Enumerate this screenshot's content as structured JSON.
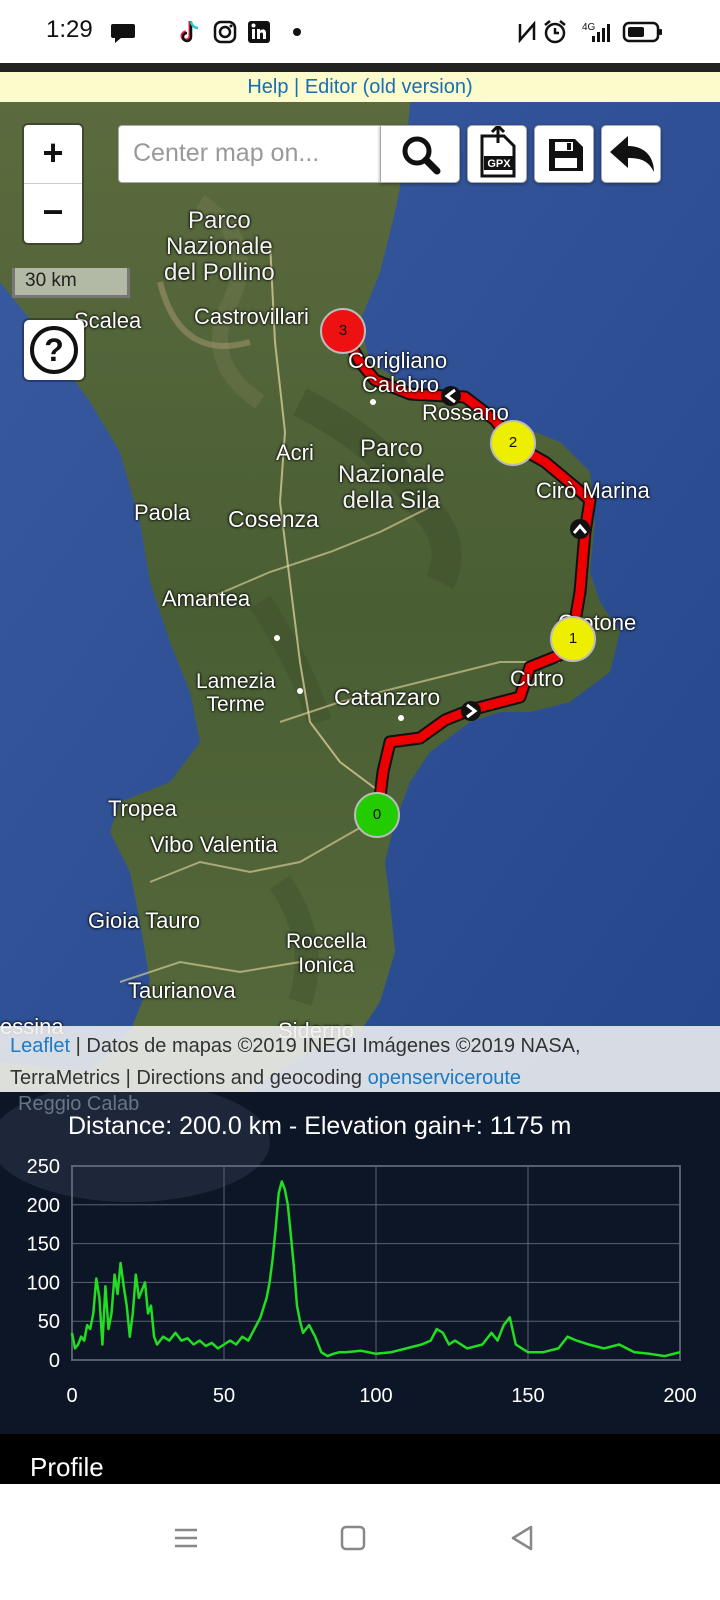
{
  "status_bar": {
    "time": "1:29",
    "icons": [
      "chat-bubble-icon",
      "tiktok-icon",
      "instagram-icon",
      "linkedin-icon",
      "dot-icon",
      "nfc-icon",
      "alarm-icon",
      "signal-4g-icon",
      "battery-icon"
    ],
    "network": "4G"
  },
  "top_links": {
    "help": "Help",
    "separator": "|",
    "editor": "Editor (old version)"
  },
  "map": {
    "zoom_in": "+",
    "zoom_out": "−",
    "search": {
      "placeholder": "Center map on..."
    },
    "toolbar": {
      "search_icon": "search-icon",
      "gpx_label": "GPX",
      "save_icon": "save-icon",
      "undo_icon": "undo-icon"
    },
    "scale": "30 km",
    "help_button": "?",
    "labels": {
      "parco_pollino": "Parco\nNazionale\ndel Pollino",
      "castrovillari": "Castrovillari",
      "scalea": "Scalea",
      "corigliano": "Corigliano",
      "calabro": "Calabro",
      "rossano": "Rossano",
      "acri": "Acri",
      "parco_sila": "Parco\nNazionale\ndella Sila",
      "ciro_marina": "Cirò Marina",
      "paola": "Paola",
      "cosenza": "Cosenza",
      "amantea": "Amantea",
      "crotone": "Crotone",
      "lamezia": "Lamezia\nTerme",
      "catanzaro": "Catanzaro",
      "cutro": "Cutro",
      "tropea": "Tropea",
      "vibo": "Vibo Valentia",
      "gioia": "Gioia Tauro",
      "roccella": "Roccella\nIonica",
      "taurianova": "Taurianova",
      "messina": "essina",
      "siderno": "Siderno",
      "reggio": "Reggio\nCalab"
    },
    "waypoints": [
      {
        "label": "0",
        "color": "#22cc00"
      },
      {
        "label": "1",
        "color": "#eeee00"
      },
      {
        "label": "2",
        "color": "#eeee00"
      },
      {
        "label": "3",
        "color": "#ee1111"
      }
    ],
    "route_color": "#ee0000",
    "attribution": {
      "leaflet": "Leaflet",
      "text1": " | Datos de mapas ©2019 INEGI Imágenes ©2019 NASA,",
      "text2": "TerraMetrics | Directions and geocoding ",
      "ors": "openserviceroute"
    }
  },
  "profile": {
    "summary": "Distance: 200.0 km  - Elevation gain+: 1175 m",
    "tab_label": "Profile"
  },
  "chart_data": {
    "type": "line",
    "title": "Distance: 200.0 km  - Elevation gain+: 1175 m",
    "xlabel": "",
    "ylabel": "",
    "xlim": [
      0,
      200
    ],
    "ylim": [
      0,
      250
    ],
    "x_ticks": [
      "0",
      "50",
      "100",
      "150",
      "200"
    ],
    "y_ticks": [
      "0",
      "50",
      "100",
      "150",
      "200",
      "250"
    ],
    "grid": true,
    "color": "#22dd22",
    "series": [
      {
        "x": [
          0,
          1,
          2,
          3,
          4,
          5,
          6,
          7,
          8,
          9,
          10,
          11,
          12,
          13,
          14,
          15,
          16,
          17,
          18,
          19,
          20,
          21,
          22,
          23,
          24,
          25,
          26,
          27,
          28,
          30,
          32,
          34,
          36,
          38,
          40,
          42,
          44,
          46,
          48,
          50,
          52,
          54,
          56,
          58,
          60,
          62,
          64,
          65,
          66,
          67,
          68,
          69,
          70,
          71,
          72,
          73,
          74,
          75,
          76,
          78,
          80,
          82,
          84,
          86,
          88,
          90,
          95,
          100,
          105,
          110,
          115,
          118,
          120,
          122,
          124,
          126,
          130,
          135,
          138,
          140,
          142,
          144,
          146,
          148,
          150,
          155,
          160,
          163,
          166,
          170,
          175,
          180,
          185,
          190,
          195,
          200
        ],
        "values": [
          35,
          15,
          20,
          30,
          25,
          45,
          40,
          60,
          105,
          80,
          20,
          95,
          40,
          60,
          110,
          85,
          125,
          95,
          70,
          30,
          60,
          110,
          80,
          90,
          100,
          60,
          70,
          30,
          20,
          30,
          25,
          35,
          25,
          28,
          20,
          25,
          18,
          22,
          15,
          20,
          25,
          20,
          30,
          25,
          40,
          55,
          80,
          100,
          130,
          170,
          215,
          230,
          220,
          200,
          160,
          120,
          70,
          50,
          35,
          45,
          30,
          10,
          5,
          8,
          10,
          10,
          12,
          8,
          10,
          15,
          20,
          25,
          40,
          35,
          20,
          25,
          15,
          20,
          35,
          25,
          45,
          55,
          20,
          15,
          10,
          10,
          15,
          30,
          25,
          20,
          15,
          20,
          10,
          8,
          5,
          10
        ]
      }
    ]
  }
}
